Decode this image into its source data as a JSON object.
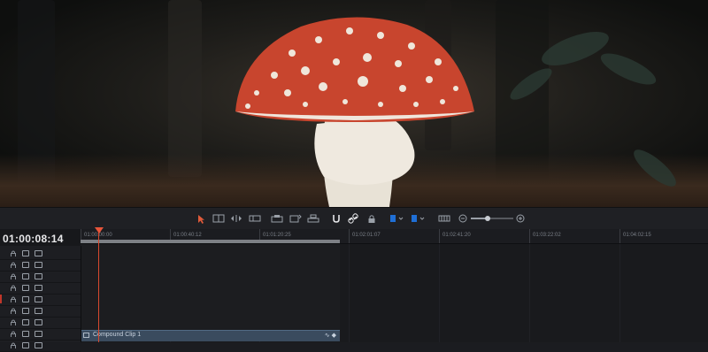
{
  "viewer": {
    "description_icon": "mushroom-frame"
  },
  "toolbar": {
    "icons": [
      "select-arrow-icon",
      "trim-edit-icon",
      "dynamic-trim-icon",
      "blade-icon",
      "overwrite-icon",
      "replace-icon",
      "place-on-top-icon",
      "snapping-icon",
      "linked-selection-icon",
      "position-lock-icon",
      "flag-icon",
      "marker-icon",
      "full-extent-zoom-icon",
      "zoom-out-icon",
      "zoom-slider",
      "zoom-in-icon"
    ],
    "accent": "#e05a3a",
    "flag_color": "#1f6fd6"
  },
  "timeline": {
    "timecode": "01:00:08:14",
    "ruler_labels": [
      "01:00:00:00",
      "01:00:40:12",
      "01:01:20:25",
      "01:02:01:07",
      "01:02:41:20",
      "01:03:22:02",
      "01:04:02:15"
    ],
    "track_count": 9,
    "clip": {
      "name": "Compound Clip 1"
    },
    "playhead_color": "#d8492f"
  }
}
